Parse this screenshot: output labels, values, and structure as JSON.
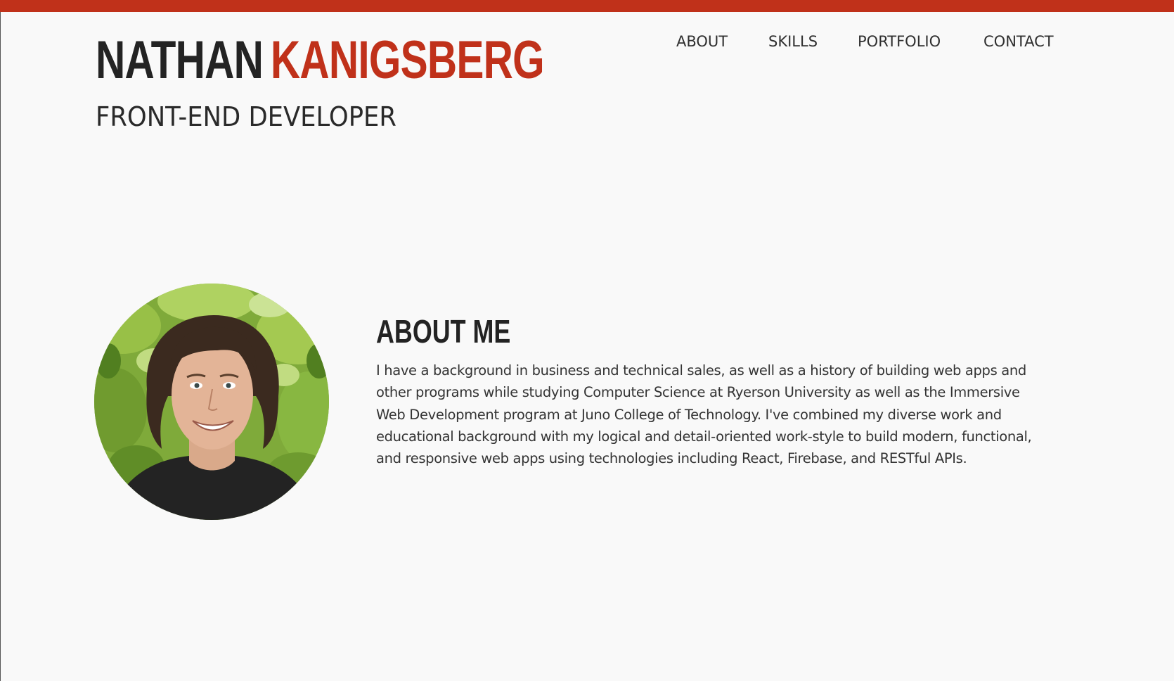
{
  "header": {
    "first_name": "NATHAN",
    "last_name": "KANIGSBERG",
    "role": "FRONT-END DEVELOPER"
  },
  "nav": {
    "items": [
      {
        "label": "ABOUT"
      },
      {
        "label": "SKILLS"
      },
      {
        "label": "PORTFOLIO"
      },
      {
        "label": "CONTACT"
      }
    ]
  },
  "about": {
    "title": "ABOUT ME",
    "body": "I have a background in business and technical sales, as well as a history of building web apps and other programs while studying Computer Science at Ryerson University as well as the Immersive Web Development program at Juno College of Technology. I've combined my diverse work and educational background with my logical and detail-oriented work-style to build modern, functional, and responsive web apps using technologies including React, Firebase, and RESTful APIs."
  },
  "colors": {
    "accent": "#c0311a",
    "background": "#f9f9f9",
    "text": "#232323"
  }
}
